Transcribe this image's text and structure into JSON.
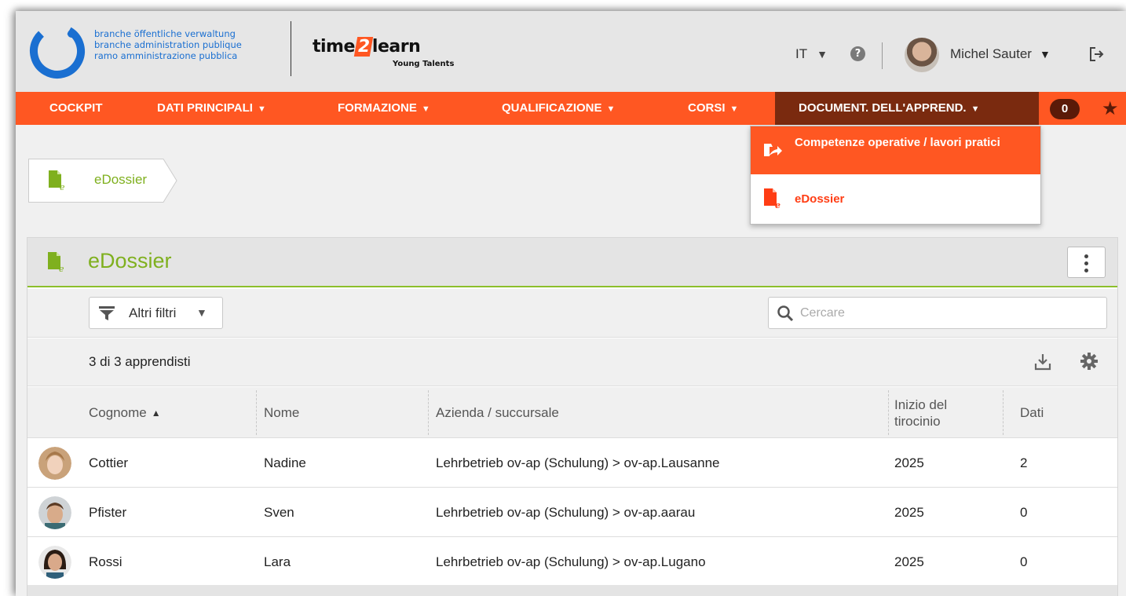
{
  "header": {
    "brand_lines": [
      "branche öffentliche verwaltung",
      "branche administration publique",
      "ramo amministrazione pubblica"
    ],
    "product_name_pre": "time",
    "product_name_num": "2",
    "product_name_post": "learn",
    "product_tagline": "Young Talents",
    "language": "IT",
    "help_label": "?",
    "user_name": "Michel Sauter"
  },
  "nav": {
    "items": [
      {
        "label": "COCKPIT"
      },
      {
        "label": "DATI PRINCIPALI"
      },
      {
        "label": "FORMAZIONE"
      },
      {
        "label": "QUALIFICAZIONE"
      },
      {
        "label": "CORSI"
      },
      {
        "label": "DOCUMENT. DELL'APPREND."
      }
    ],
    "notification_count": "0"
  },
  "dropdown": {
    "items": [
      {
        "label": "Competenze operative / lavori pratici"
      },
      {
        "label": "eDossier"
      }
    ]
  },
  "breadcrumb": {
    "label": "eDossier"
  },
  "panel": {
    "title": "eDossier",
    "filter_label": "Altri filtri",
    "search_placeholder": "Cercare",
    "count_text": "3 di 3 apprendisti"
  },
  "table": {
    "columns": [
      "Cognome",
      "Nome",
      "Azienda / succursale",
      "Inizio del tirocinio",
      "Dati"
    ],
    "rows": [
      {
        "cognome": "Cottier",
        "nome": "Nadine",
        "azienda": "Lehrbetrieb ov-ap (Schulung) > ov-ap.Lausanne",
        "inizio": "2025",
        "dati": "2"
      },
      {
        "cognome": "Pfister",
        "nome": "Sven",
        "azienda": "Lehrbetrieb ov-ap (Schulung) > ov-ap.aarau",
        "inizio": "2025",
        "dati": "0"
      },
      {
        "cognome": "Rossi",
        "nome": "Lara",
        "azienda": "Lehrbetrieb ov-ap (Schulung) > ov-ap.Lugano",
        "inizio": "2025",
        "dati": "0"
      }
    ]
  },
  "colors": {
    "accent": "#ff5722",
    "active_nav": "#7a2a0f",
    "brand_blue": "#1a6fd1",
    "green": "#7fb01e"
  }
}
